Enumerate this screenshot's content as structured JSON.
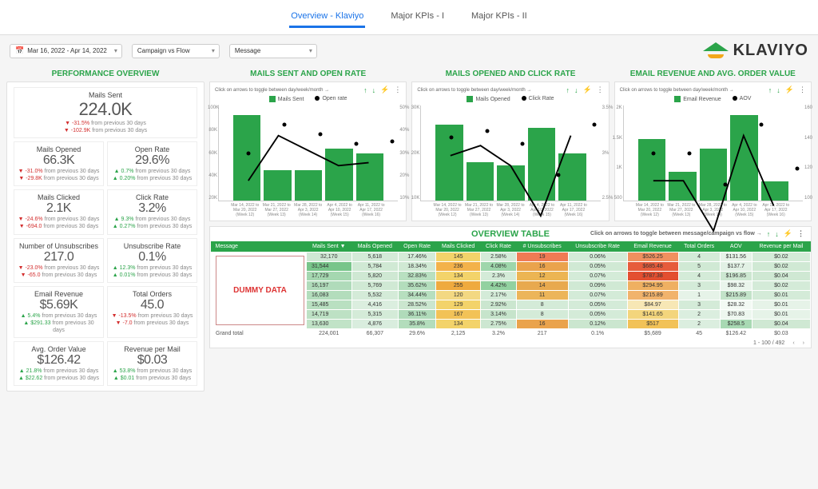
{
  "tabs": {
    "t1": "Overview - Klaviyo",
    "t2": "Major KPIs - I",
    "t3": "Major KPIs - II"
  },
  "dropdowns": {
    "date": "Mar 16, 2022 - Apr 14, 2022",
    "seg": "Campaign vs Flow",
    "msg": "Message"
  },
  "logo": "KLAVIYO",
  "titles": {
    "perf": "PERFORMANCE OVERVIEW",
    "c1": "MAILS SENT AND OPEN RATE",
    "c2": "MAILS OPENED AND CLICK RATE",
    "c3": "EMAIL REVENUE AND AVG. ORDER VALUE",
    "table": "OVERVIEW TABLE"
  },
  "hint_chart": "Click on arrows to toggle between day/week/month →",
  "hint_table": "Click on arrows to toggle between message/campaign vs flow →",
  "chart_data": [
    {
      "type": "bar+line",
      "title": "MAILS SENT AND OPEN RATE",
      "series": [
        {
          "name": "Mails Sent",
          "values": [
            90000,
            32000,
            32000,
            55000,
            50000
          ],
          "axis": "left"
        },
        {
          "name": "Open rate",
          "values": [
            25,
            40,
            35,
            30,
            31
          ],
          "axis": "right"
        }
      ],
      "ylim_left": [
        0,
        100000
      ],
      "yticks_left": [
        "100K",
        "80K",
        "60K",
        "40K",
        "20K"
      ],
      "ylim_right": [
        0,
        50
      ],
      "yticks_right": [
        "50%",
        "40%",
        "30%",
        "20%",
        "10%"
      ],
      "categories": [
        "Mar 14, 2022 to Mar 20, 2022 (Week 12)",
        "Mar 21, 2022 to Mar 27, 2022 (Week 13)",
        "Mar 28, 2022 to Apr 3, 2022 (Week 14)",
        "Apr 4, 2022 to Apr 10, 2022 (Week 15)",
        "Apr 11, 2022 to Apr 17, 2022 (Week 16)"
      ]
    },
    {
      "type": "bar+line",
      "title": "MAILS OPENED AND CLICK RATE",
      "series": [
        {
          "name": "Mails Opened",
          "values": [
            24000,
            12000,
            11000,
            23000,
            15000
          ],
          "axis": "left"
        },
        {
          "name": "Click Rate",
          "values": [
            3.0,
            3.1,
            2.9,
            2.4,
            3.2
          ],
          "axis": "right"
        }
      ],
      "ylim_left": [
        0,
        30000
      ],
      "yticks_left": [
        "30K",
        "20K",
        "10K"
      ],
      "ylim_right": [
        2.0,
        3.5
      ],
      "yticks_right": [
        "3.5%",
        "3%",
        "2.5%"
      ],
      "categories": [
        "Mar 14, 2022 to Mar 20, 2022 (Week 12)",
        "Mar 21, 2022 to Mar 27, 2022 (Week 13)",
        "Mar 28, 2022 to Apr 3, 2022 (Week 14)",
        "Apr 4, 2022 to Apr 10, 2022 (Week 15)",
        "Apr 11, 2022 to Apr 17, 2022 (Week 16)"
      ]
    },
    {
      "type": "bar+line",
      "title": "EMAIL REVENUE AND AVG. ORDER VALUE",
      "series": [
        {
          "name": "Email Revenue",
          "values": [
            1300,
            600,
            1100,
            1800,
            400
          ],
          "axis": "left"
        },
        {
          "name": "AOV",
          "values": [
            130,
            130,
            110,
            148,
            120
          ],
          "axis": "right"
        }
      ],
      "ylim_left": [
        0,
        2000
      ],
      "yticks_left": [
        "2K",
        "1.5K",
        "1K",
        "500"
      ],
      "ylim_right": [
        100,
        160
      ],
      "yticks_right": [
        "160",
        "140",
        "120",
        "100"
      ],
      "categories": [
        "Mar 14, 2022 to Mar 20, 2022 (Week 12)",
        "Mar 21, 2022 to Mar 27, 2022 (Week 13)",
        "Mar 28, 2022 to Apr 3, 2022 (Week 14)",
        "Apr 4, 2022 to Apr 10, 2022 (Week 15)",
        "Apr 11, 2022 to Apr 17, 2022 (Week 16)"
      ]
    }
  ],
  "metrics": [
    {
      "label": "Mails Sent",
      "value": "224.0K",
      "d1v": "-31.5%",
      "d1c": "down",
      "d2v": "-102.9K",
      "d2c": "down"
    },
    {
      "label": "Mails Opened",
      "value": "66.3K",
      "d1v": "-31.0%",
      "d1c": "down",
      "d2v": "-29.8K",
      "d2c": "down"
    },
    {
      "label": "Open Rate",
      "value": "29.6%",
      "d1v": "0.7%",
      "d1c": "up",
      "d2v": "0.20%",
      "d2c": "up"
    },
    {
      "label": "Mails Clicked",
      "value": "2.1K",
      "d1v": "-24.6%",
      "d1c": "down",
      "d2v": "-694.0",
      "d2c": "down"
    },
    {
      "label": "Click Rate",
      "value": "3.2%",
      "d1v": "9.3%",
      "d1c": "up",
      "d2v": "0.27%",
      "d2c": "up"
    },
    {
      "label": "Number of Unsubscribes",
      "value": "217.0",
      "d1v": "-23.0%",
      "d1c": "down",
      "d2v": "-65.0",
      "d2c": "down"
    },
    {
      "label": "Unsubscribe Rate",
      "value": "0.1%",
      "d1v": "12.3%",
      "d1c": "up",
      "d2v": "0.01%",
      "d2c": "up"
    },
    {
      "label": "Email Revenue",
      "value": "$5.69K",
      "d1v": "5.4%",
      "d1c": "up",
      "d2v": "$291.33",
      "d2c": "up"
    },
    {
      "label": "Total Orders",
      "value": "45.0",
      "d1v": "-13.5%",
      "d1c": "down",
      "d2v": "-7.0",
      "d2c": "down"
    },
    {
      "label": "Avg. Order Value",
      "value": "$126.42",
      "d1v": "21.8%",
      "d1c": "up",
      "d2v": "$22.62",
      "d2c": "up"
    },
    {
      "label": "Revenue per Mail",
      "value": "$0.03",
      "d1v": "53.8%",
      "d1c": "up",
      "d2v": "$0.01",
      "d2c": "up"
    }
  ],
  "delta_suffix": " from previous 30 days",
  "table": {
    "headers": [
      "Message",
      "Mails Sent ▼",
      "Mails Opened",
      "Open Rate",
      "Mails Clicked",
      "Click Rate",
      "# Unsubscribes",
      "Unsubscribe Rate",
      "Email Revenue",
      "Total Orders",
      "AOV",
      "Revenue per Mail"
    ],
    "rows": [
      [
        "",
        "32,170",
        "5,618",
        "17.46%",
        "145",
        "2.58%",
        "19",
        "0.06%",
        "$526.25",
        "4",
        "$131.56",
        "$0.02"
      ],
      [
        "",
        "31,544",
        "5,784",
        "18.34%",
        "236",
        "4.08%",
        "16",
        "0.05%",
        "$685.48",
        "5",
        "$137.7",
        "$0.02"
      ],
      [
        "",
        "17,729",
        "5,820",
        "32.83%",
        "134",
        "2.3%",
        "12",
        "0.07%",
        "$787.38",
        "4",
        "$196.85",
        "$0.04"
      ],
      [
        "",
        "16,197",
        "5,769",
        "35.62%",
        "255",
        "4.42%",
        "14",
        "0.09%",
        "$294.95",
        "3",
        "$98.32",
        "$0.02"
      ],
      [
        "",
        "16,083",
        "5,532",
        "34.44%",
        "120",
        "2.17%",
        "11",
        "0.07%",
        "$215.89",
        "1",
        "$215.89",
        "$0.01"
      ],
      [
        "",
        "15,485",
        "4,416",
        "28.52%",
        "129",
        "2.92%",
        "8",
        "0.05%",
        "$84.97",
        "3",
        "$28.32",
        "$0.01"
      ],
      [
        "",
        "14,719",
        "5,315",
        "36.11%",
        "167",
        "3.14%",
        "8",
        "0.05%",
        "$141.65",
        "2",
        "$70.83",
        "$0.01"
      ],
      [
        "",
        "13,630",
        "4,876",
        "35.8%",
        "134",
        "2.75%",
        "16",
        "0.12%",
        "$517",
        "2",
        "$258.5",
        "$0.04"
      ]
    ],
    "grand": [
      "Grand total",
      "224,001",
      "66,307",
      "29.6%",
      "2,125",
      "3.2%",
      "217",
      "0.1%",
      "$5,689",
      "45",
      "$126.42",
      "$0.03"
    ],
    "dummy": "DUMMY DATA",
    "pager": "1 - 100 / 492"
  },
  "heat": {
    "cols": [
      1,
      2,
      3,
      4,
      5,
      6,
      7,
      8,
      9,
      10,
      11
    ],
    "colors": {
      "0": [
        "#cfe8d4",
        "#d4ebd8",
        "#d4ebd8",
        "#f3d36a",
        "#d4ebd8",
        "#f07b54",
        "#d4ebd8",
        "#f0905f",
        "#d4ebd8",
        "#e6f3e8",
        "#d4ebd8"
      ],
      "1": [
        "#78c58a",
        "#d0e9d4",
        "#d0e9d4",
        "#f3b24a",
        "#9ed6ab",
        "#eaa34c",
        "#d0e9d4",
        "#e65c3b",
        "#d0e9d4",
        "#e2f1e5",
        "#d0e9d4"
      ],
      "2": [
        "#a5d7b0",
        "#cfe8d3",
        "#b9e0c1",
        "#f3d36a",
        "#d4ebd8",
        "#ecb553",
        "#d4ebd8",
        "#e34f30",
        "#d4ebd8",
        "#cde7d1",
        "#cfe8d3"
      ],
      "3": [
        "#b0dbba",
        "#d0e9d4",
        "#b3ddbc",
        "#efaa3e",
        "#92d1a0",
        "#e8a94e",
        "#d0e9d4",
        "#efb061",
        "#d4ebd8",
        "#eaf5ec",
        "#d4ebd8"
      ],
      "4": [
        "#b3ddbc",
        "#d4ebd8",
        "#b7dfbf",
        "#f3d882",
        "#d4ebd8",
        "#ecb55a",
        "#d4ebd8",
        "#f1b36c",
        "#e6f3e8",
        "#c3e3c9",
        "#d4ebd8"
      ],
      "5": [
        "#b9e0c1",
        "#dbeedf",
        "#cbe6cf",
        "#f3d36a",
        "#cbe6cf",
        "#d4ebd8",
        "#d4ebd8",
        "#f7e7b5",
        "#d4ebd8",
        "#f3faf4",
        "#e6f3e8"
      ],
      "6": [
        "#bde1c4",
        "#d4ebd8",
        "#b0dbba",
        "#f2c257",
        "#c6e4cb",
        "#d4ebd8",
        "#d4ebd8",
        "#f3d57c",
        "#dbeedf",
        "#edf7ef",
        "#e6f3e8"
      ],
      "7": [
        "#c1e3c7",
        "#d9edde",
        "#b3ddbc",
        "#f3d36a",
        "#cde7d1",
        "#eaa34c",
        "#cbe6cf",
        "#f2c257",
        "#dbeedf",
        "#a8d9b3",
        "#cfe8d3"
      ]
    }
  }
}
